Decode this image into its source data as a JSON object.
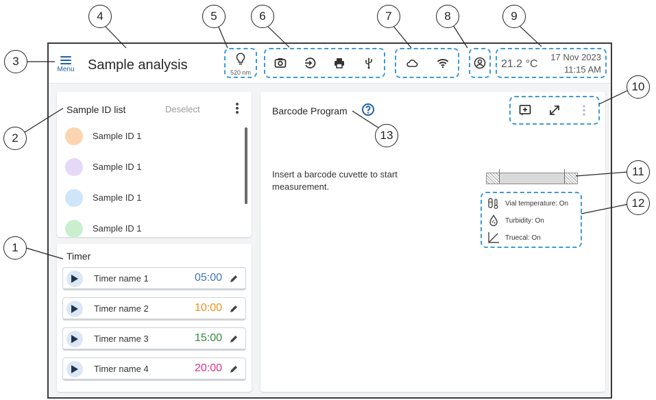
{
  "header": {
    "menu_label": "Menu",
    "title": "Sample analysis",
    "lamp_wavelength": "520 nm",
    "temperature": "21.2 °C",
    "date": "17 Nov 2023",
    "time": "11:15 AM",
    "icons": {
      "lamp": "lightbulb-icon",
      "group6": [
        "camera-icon",
        "login-icon",
        "printer-icon",
        "usb-icon"
      ],
      "group7": [
        "cloud-icon",
        "wifi-icon"
      ],
      "group8": [
        "user-account-icon"
      ]
    }
  },
  "sample_list": {
    "title": "Sample ID list",
    "deselect_label": "Deselect",
    "items": [
      {
        "label": "Sample ID 1",
        "color": "#fcd5b0"
      },
      {
        "label": "Sample ID 1",
        "color": "#e6d8f7"
      },
      {
        "label": "Sample ID 1",
        "color": "#cfe5f8"
      },
      {
        "label": "Sample ID 1",
        "color": "#c8f0cf"
      }
    ]
  },
  "timer": {
    "title": "Timer",
    "items": [
      {
        "name": "Timer name 1",
        "time": "05:00",
        "color": "#3f73b8"
      },
      {
        "name": "Timer name 2",
        "time": "10:00",
        "color": "#e8901e"
      },
      {
        "name": "Timer name 3",
        "time": "15:00",
        "color": "#2f8a3a"
      },
      {
        "name": "Timer name 4",
        "time": "20:00",
        "color": "#d6348e"
      }
    ]
  },
  "main": {
    "title": "Barcode Program",
    "message": "Insert a barcode cuvette to start measurement.",
    "toolbar_icons": [
      "add-comment-icon",
      "expand-icon",
      "more-vertical-icon"
    ],
    "properties": [
      {
        "label": "Vial temperature: On",
        "icon": "vial-temperature-icon"
      },
      {
        "label": "Turbidity: On",
        "icon": "turbidity-icon"
      },
      {
        "label": "Truecal: On",
        "icon": "truecal-icon"
      }
    ]
  },
  "callouts": [
    "1",
    "2",
    "3",
    "4",
    "5",
    "6",
    "7",
    "8",
    "9",
    "10",
    "11",
    "12",
    "13"
  ],
  "colors": {
    "accent": "#1f5fa8",
    "callout_border": "#3a9ad9"
  }
}
